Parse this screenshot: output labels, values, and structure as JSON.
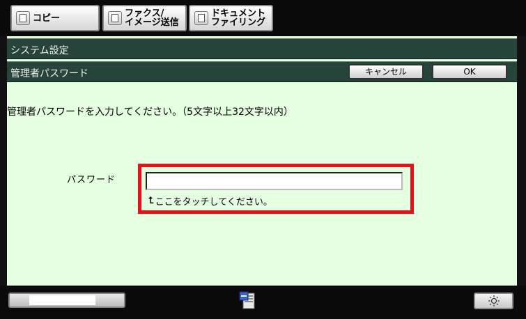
{
  "tabs": [
    {
      "label": "コピー"
    },
    {
      "label": "ファクス/\nイメージ送信"
    },
    {
      "label": "ドキュメント\nファイリング"
    }
  ],
  "header": {
    "title": "システム設定",
    "subtitle": "管理者パスワード",
    "cancel_label": "キャンセル",
    "ok_label": "OK"
  },
  "form": {
    "instruction": "管理者パスワードを入力してください。（5文字以上32文字以内）",
    "password_label": "パスワード",
    "password_value": "",
    "hint": "ここをタッチしてください。"
  },
  "status": {
    "progress": 0.7
  },
  "icons": {
    "tab_icon": "document-icon",
    "job_icon": "job-status-icon",
    "brightness": "sun-icon",
    "hint_arrow": "return-arrow-icon"
  },
  "colors": {
    "panel_bg": "#e5fde1",
    "header_bar": "#26443a",
    "highlight": "#e8101a"
  }
}
